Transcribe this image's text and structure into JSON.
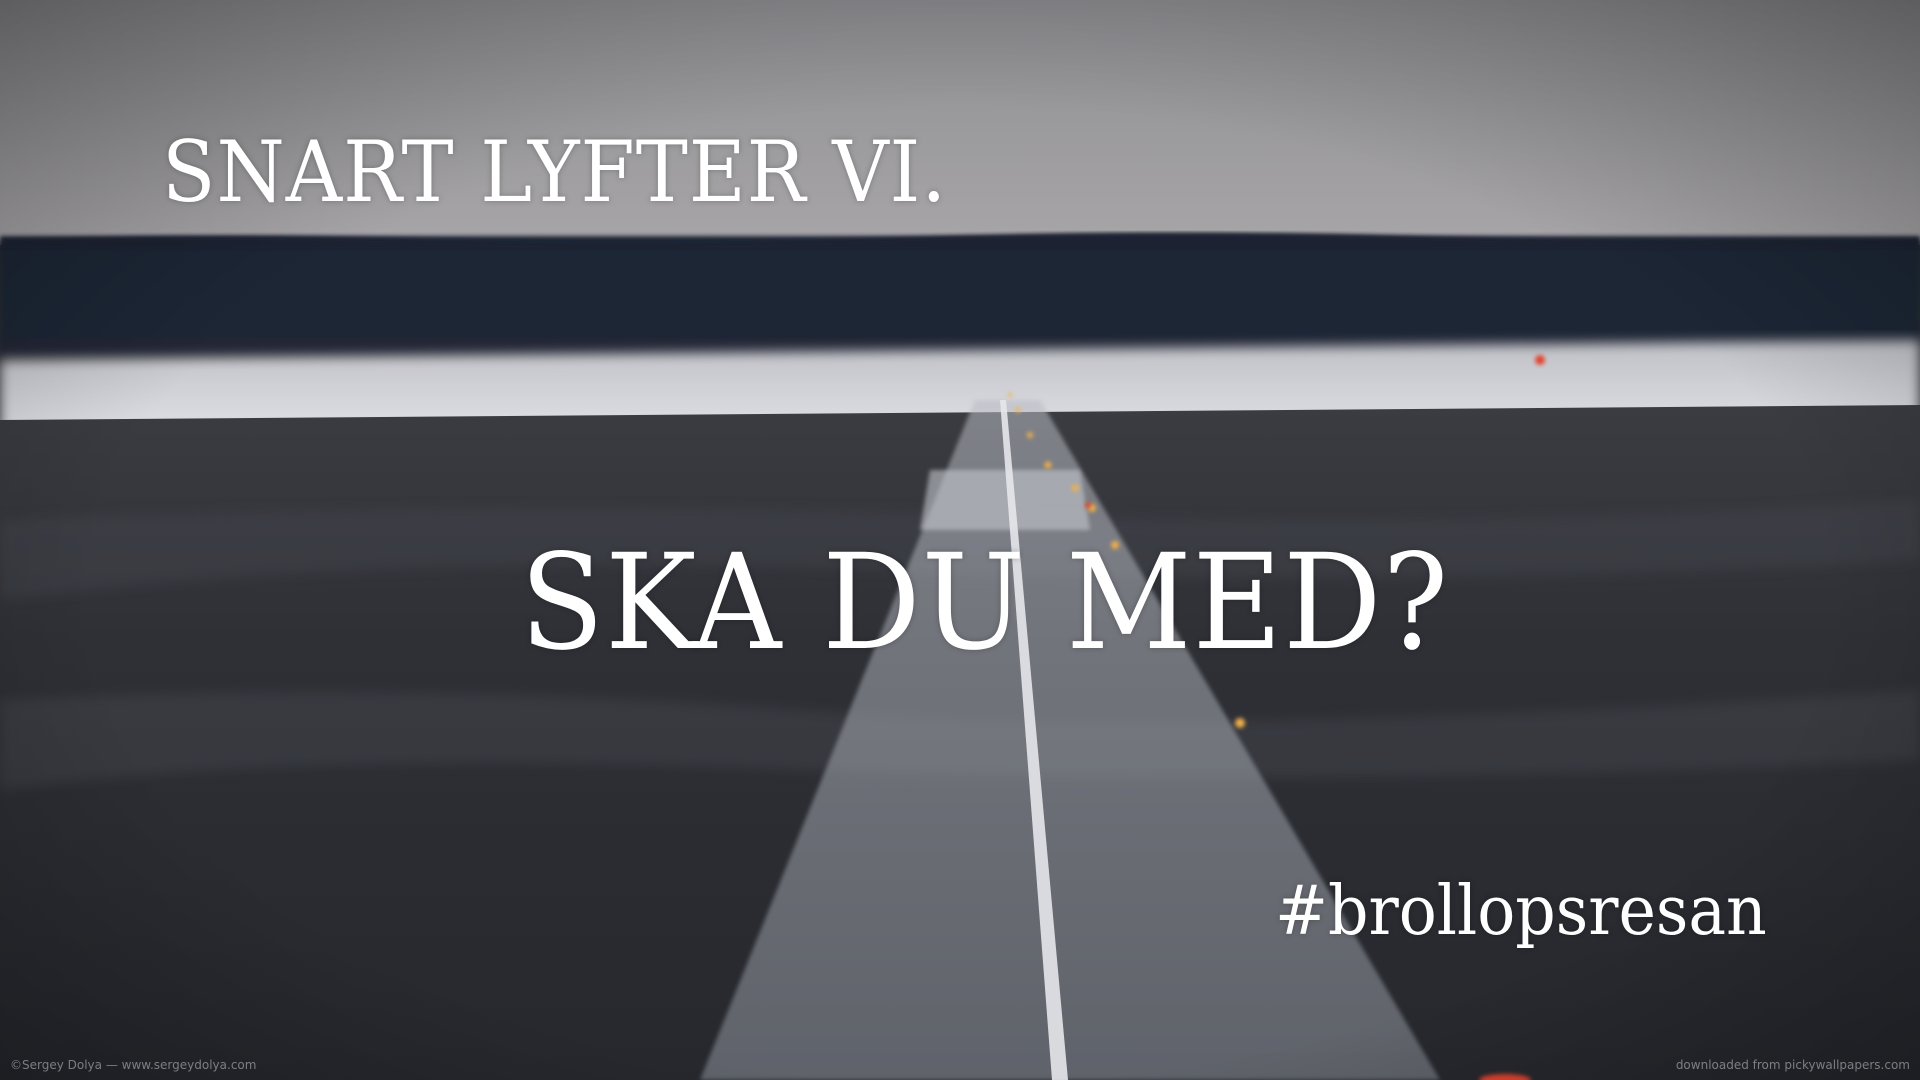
{
  "overlay": {
    "headline": "SNART LYFTER VI.",
    "question": "SKA DU MED?",
    "hashtag": "#brollopsresan"
  },
  "credits": {
    "left": "©Sergey Dolya — www.sergeydolya.com",
    "right": "downloaded from pickywallpapers.com"
  },
  "colors": {
    "sky": "#9a9a9e",
    "tree_line": "#1c2230",
    "snow": "#d6d8de",
    "asphalt": "#2b2d33",
    "runway_stripe": "#c9ccd3",
    "text": "#ffffff"
  }
}
